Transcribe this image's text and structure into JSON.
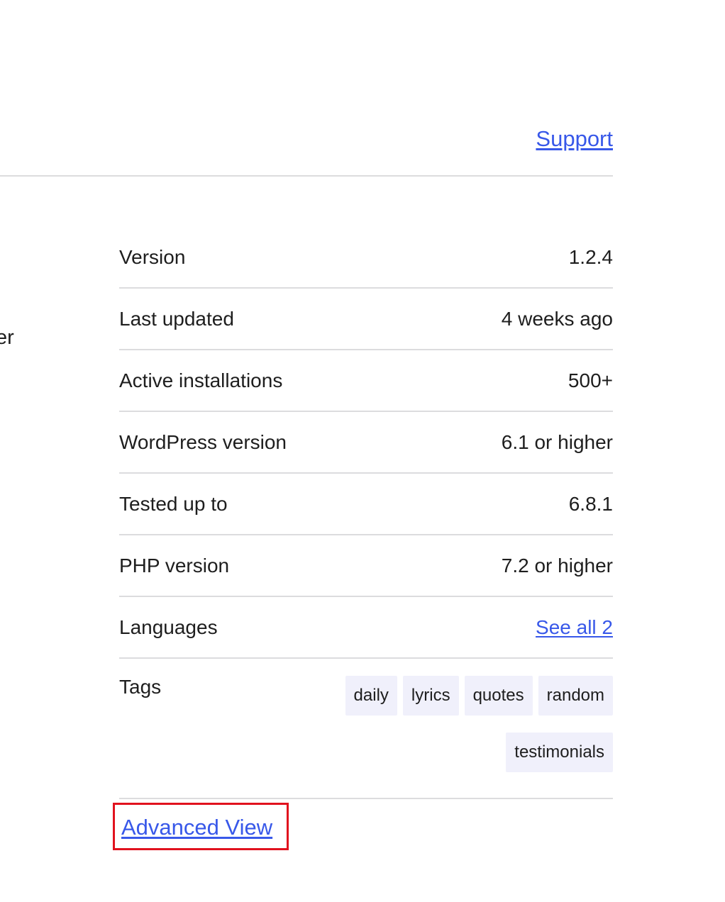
{
  "header": {
    "support_label": "Support"
  },
  "left_fragment": {
    "text": "er"
  },
  "meta": {
    "rows": [
      {
        "label": "Version",
        "value": "1.2.4"
      },
      {
        "label": "Last updated",
        "value": "4 weeks ago"
      },
      {
        "label": "Active installations",
        "value": "500+"
      },
      {
        "label": "WordPress version",
        "value": "6.1 or higher"
      },
      {
        "label": "Tested up to",
        "value": "6.8.1"
      },
      {
        "label": "PHP version",
        "value": "7.2 or higher"
      }
    ],
    "languages": {
      "label": "Languages",
      "link": "See all 2"
    },
    "tags": {
      "label": "Tags",
      "items": [
        "daily",
        "lyrics",
        "quotes",
        "random",
        "testimonials"
      ]
    }
  },
  "footer": {
    "advanced_view_label": "Advanced View"
  },
  "colors": {
    "link": "#3858e9",
    "divider": "#dcdcde",
    "tag_bg": "#f0f0fb",
    "highlight_border": "#e1121e"
  }
}
